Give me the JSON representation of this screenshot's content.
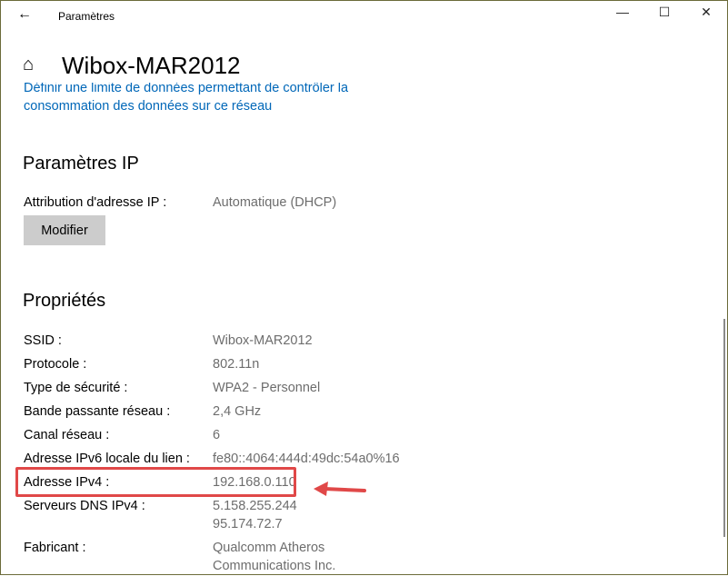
{
  "window": {
    "title": "Paramètres",
    "back": "←",
    "minimize": "—",
    "maximize": "☐",
    "close": "✕"
  },
  "header": {
    "title": "Wibox-MAR2012",
    "home_icon": "⌂"
  },
  "data_limit_link": {
    "line1": "Définir une limite de données permettant de contrôler la",
    "line2": "consommation des données sur ce réseau"
  },
  "ip_settings": {
    "heading": "Paramètres IP",
    "label": "Attribution d'adresse IP :",
    "value": "Automatique (DHCP)",
    "button": "Modifier"
  },
  "properties": {
    "heading": "Propriétés",
    "rows": [
      {
        "label": "SSID :",
        "values": [
          "Wibox-MAR2012"
        ]
      },
      {
        "label": "Protocole :",
        "values": [
          "802.11n"
        ]
      },
      {
        "label": "Type de sécurité :",
        "values": [
          "WPA2 - Personnel"
        ]
      },
      {
        "label": "Bande passante réseau :",
        "values": [
          "2,4 GHz"
        ]
      },
      {
        "label": "Canal réseau :",
        "values": [
          "6"
        ]
      },
      {
        "label": "Adresse IPv6 locale du lien :",
        "values": [
          "fe80::4064:444d:49dc:54a0%16"
        ]
      },
      {
        "label": "Adresse IPv4 :",
        "values": [
          "192.168.0.110"
        ]
      },
      {
        "label": "Serveurs DNS IPv4 :",
        "values": [
          "5.158.255.244",
          "95.174.72.7"
        ]
      },
      {
        "label": "Fabricant :",
        "values": [
          "Qualcomm Atheros",
          "Communications Inc."
        ]
      }
    ]
  },
  "annotation_color": "#e04848"
}
